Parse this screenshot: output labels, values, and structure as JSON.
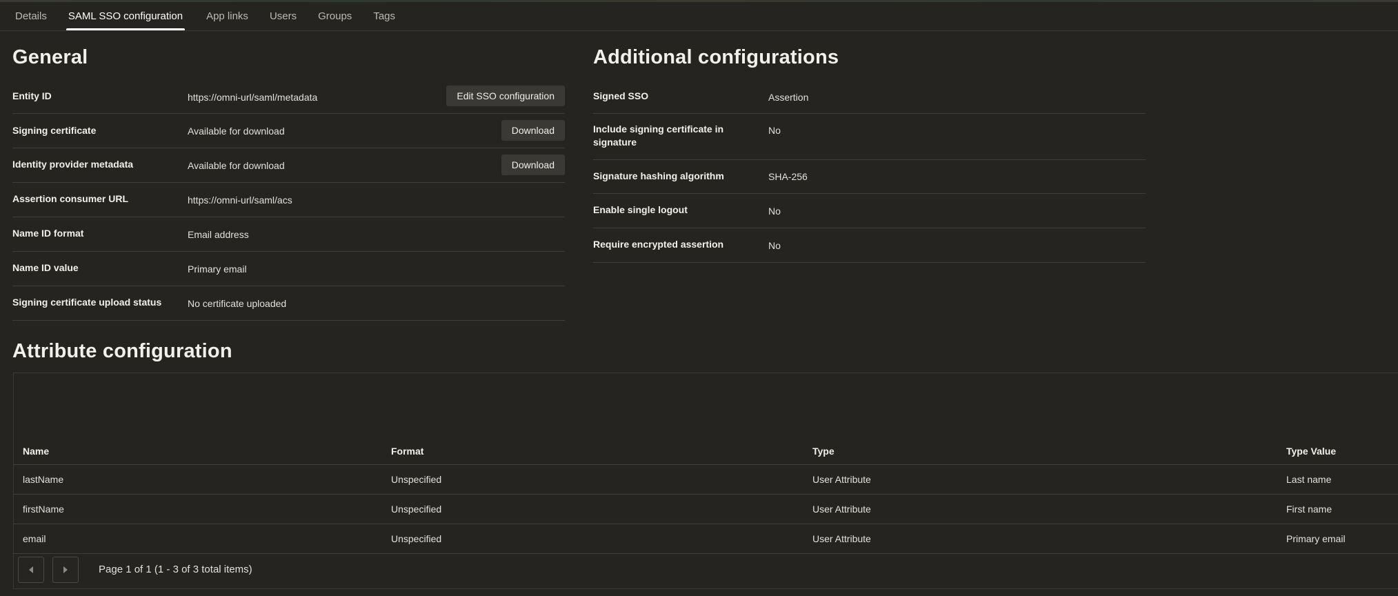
{
  "tabs": [
    {
      "label": "Details"
    },
    {
      "label": "SAML SSO configuration"
    },
    {
      "label": "App links"
    },
    {
      "label": "Users"
    },
    {
      "label": "Groups"
    },
    {
      "label": "Tags"
    }
  ],
  "active_tab": "SAML SSO configuration",
  "general": {
    "title": "General",
    "rows": [
      {
        "label": "Entity ID",
        "value": "https://omni-url/saml/metadata",
        "button": "Edit SSO configuration"
      },
      {
        "label": "Signing certificate",
        "value": "Available for download",
        "button": "Download"
      },
      {
        "label": "Identity provider metadata",
        "value": "Available for download",
        "button": "Download"
      },
      {
        "label": "Assertion consumer URL",
        "value": "https://omni-url/saml/acs"
      },
      {
        "label": "Name ID format",
        "value": "Email address"
      },
      {
        "label": "Name ID value",
        "value": "Primary email"
      },
      {
        "label": "Signing certificate upload status",
        "value": "No certificate uploaded"
      }
    ]
  },
  "additional": {
    "title": "Additional configurations",
    "rows": [
      {
        "label": "Signed SSO",
        "value": "Assertion"
      },
      {
        "label": "Include signing certificate in signature",
        "value": "No"
      },
      {
        "label": "Signature hashing algorithm",
        "value": "SHA-256"
      },
      {
        "label": "Enable single logout",
        "value": "No"
      },
      {
        "label": "Require encrypted assertion",
        "value": "No"
      }
    ]
  },
  "attributes": {
    "title": "Attribute configuration",
    "columns": [
      "Name",
      "Format",
      "Type",
      "Type Value"
    ],
    "rows": [
      [
        "lastName",
        "Unspecified",
        "User Attribute",
        "Last name"
      ],
      [
        "firstName",
        "Unspecified",
        "User Attribute",
        "First name"
      ],
      [
        "email",
        "Unspecified",
        "User Attribute",
        "Primary email"
      ]
    ],
    "pagination": "Page 1 of 1 (1 - 3 of 3 total items)"
  },
  "icons": {
    "prev": "caret-left-icon",
    "next": "caret-right-icon"
  }
}
